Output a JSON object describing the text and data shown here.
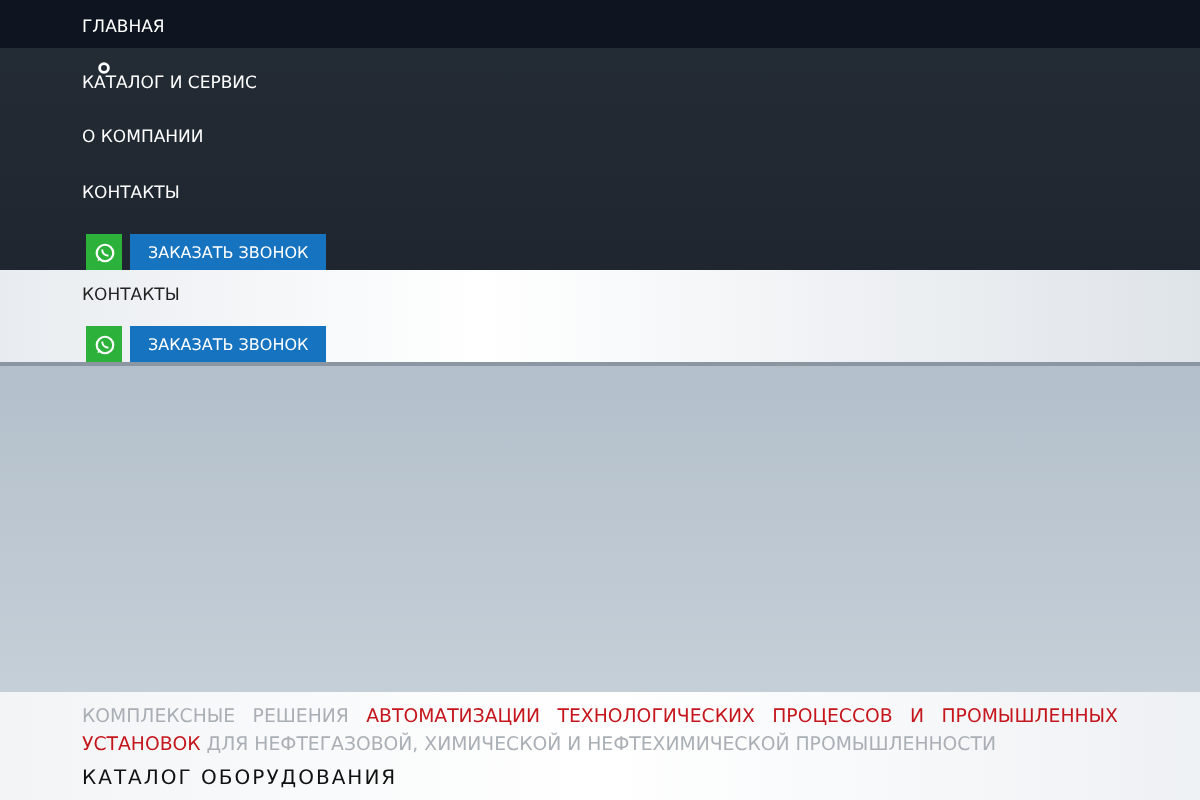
{
  "menu": {
    "items": [
      {
        "label": "ГЛАВНАЯ"
      },
      {
        "label": "КАТАЛОГ И СЕРВИС"
      },
      {
        "label": "О КОМПАНИИ"
      },
      {
        "label": "КОНТАКТЫ"
      }
    ],
    "callback_button": "ЗАКАЗАТЬ ЗВОНОК"
  },
  "sticky_menu": {
    "items": [
      {
        "label": "КОНТАКТЫ"
      }
    ],
    "callback_button": "ЗАКАЗАТЬ ЗВОНОК"
  },
  "tagline": "КОМПЛЕКСНЫЕ РЕШЕНИЯ **АВТОМАТИЗАЦИИ ТЕХНОЛОГИЧЕСКИХ ПРОЦЕССОВ И ПРОМЫШЛЕННЫХ УСТАНОВОК** ДЛЯ НЕФТЕГАЗОВОЙ, ХИМИЧЕСКОЙ И НЕФТЕХИМИЧЕСКОЙ ПРОМЫШЛЕННОСТИ",
  "heading": "КАТАЛОГ ОБОРУДОВАНИЯ"
}
